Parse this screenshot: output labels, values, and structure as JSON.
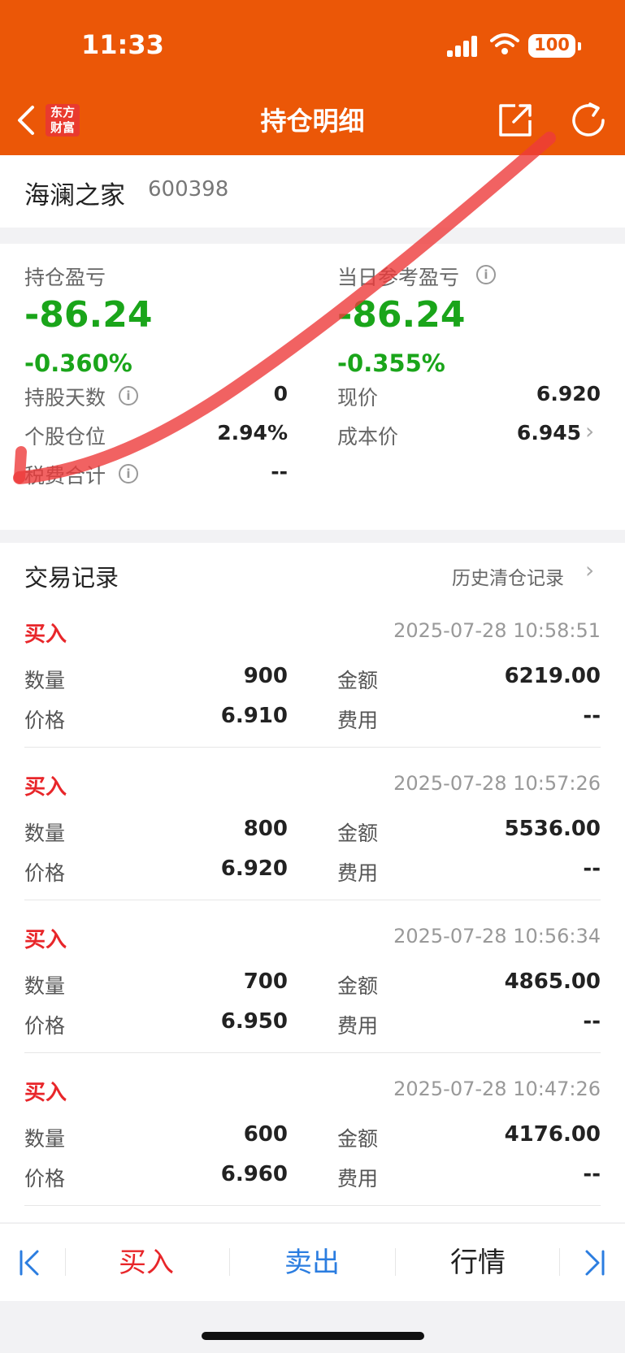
{
  "status": {
    "time": "11:33",
    "battery": "100"
  },
  "header": {
    "logo_line1": "东方",
    "logo_line2": "财富",
    "title": "持仓明细"
  },
  "stock": {
    "name": "海澜之家",
    "code": "600398"
  },
  "summary": {
    "holding_pl_label": "持仓盈亏",
    "holding_pl_value": "-86.24",
    "holding_pl_pct": "-0.360%",
    "daily_pl_label": "当日参考盈亏",
    "daily_pl_value": "-86.24",
    "daily_pl_pct": "-0.355%",
    "hold_days_label": "持股天数",
    "hold_days_value": "0",
    "price_label": "现价",
    "price_value": "6.920",
    "position_label": "个股仓位",
    "position_value": "2.94%",
    "cost_label": "成本价",
    "cost_value": "6.945",
    "fees_label": "税费合计",
    "fees_value": "--"
  },
  "trades": {
    "title": "交易记录",
    "history_link": "历史清仓记录",
    "labels": {
      "qty": "数量",
      "price": "价格",
      "amount": "金额",
      "fee": "费用"
    },
    "records": [
      {
        "type": "买入",
        "time": "2025-07-28 10:58:51",
        "qty": "900",
        "price": "6.910",
        "amount": "6219.00",
        "fee": "--"
      },
      {
        "type": "买入",
        "time": "2025-07-28 10:57:26",
        "qty": "800",
        "price": "6.920",
        "amount": "5536.00",
        "fee": "--"
      },
      {
        "type": "买入",
        "time": "2025-07-28 10:56:34",
        "qty": "700",
        "price": "6.950",
        "amount": "4865.00",
        "fee": "--"
      },
      {
        "type": "买入",
        "time": "2025-07-28 10:47:26",
        "qty": "600",
        "price": "6.960",
        "amount": "4176.00",
        "fee": "--"
      }
    ]
  },
  "toolbar": {
    "buy": "买入",
    "sell": "卖出",
    "market": "行情"
  },
  "colors": {
    "brand": "#eb5707",
    "loss_green": "#1aa51a",
    "buy_red": "#e8262a",
    "sell_blue": "#2b7de0"
  }
}
